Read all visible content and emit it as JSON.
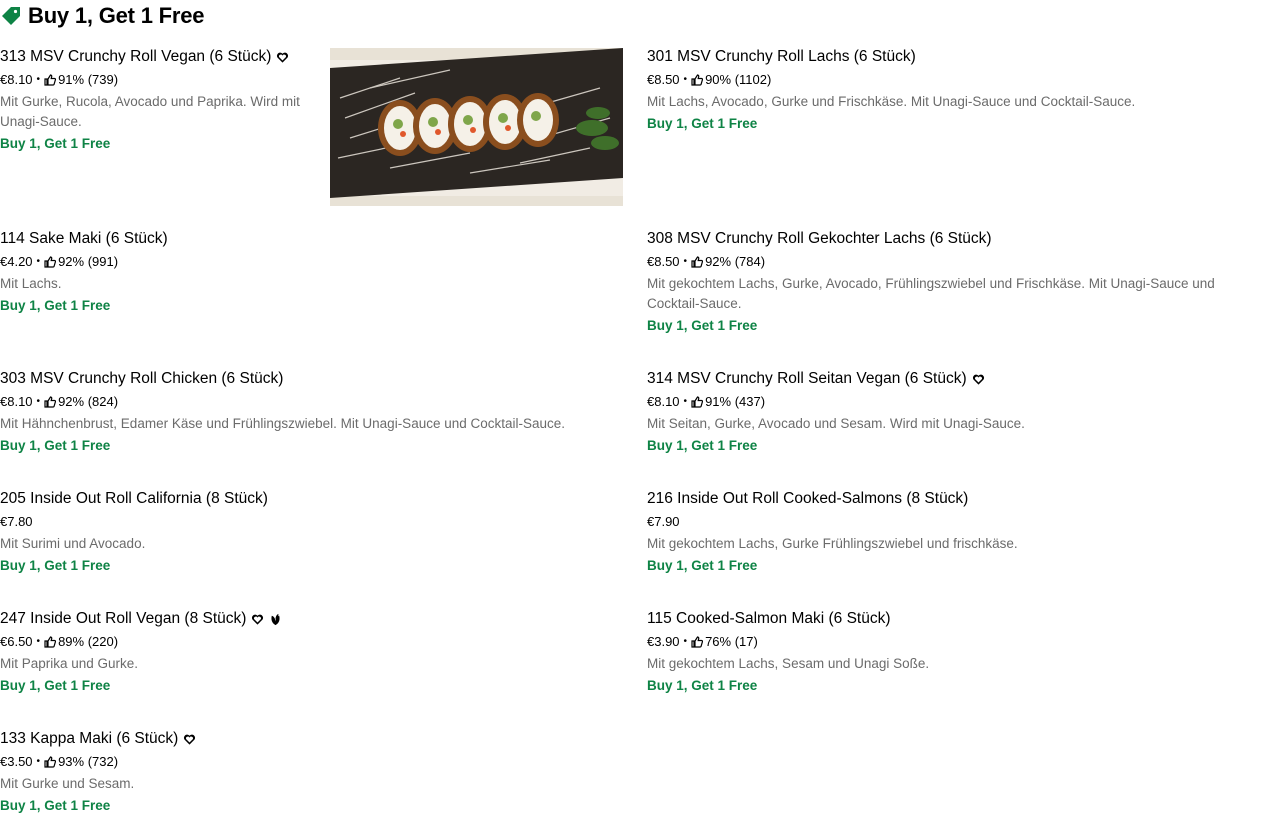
{
  "section": {
    "title": "Buy 1, Get 1 Free",
    "icon": "tag-icon",
    "accent": "#0e8345"
  },
  "items": [
    {
      "title": "313 MSV Crunchy Roll Vegan (6 Stück)",
      "price": "€8.10",
      "rating": "91% (739)",
      "desc": "Mit Gurke, Rucola, Avocado und Paprika. Wird mit Unagi-Sauce.",
      "promo": "Buy 1, Get 1 Free",
      "badges": [
        "heart-icon"
      ],
      "has_image": true
    },
    {
      "title": "301 MSV Crunchy Roll Lachs (6 Stück)",
      "price": "€8.50",
      "rating": "90% (1102)",
      "desc": "Mit Lachs, Avocado, Gurke und Frischkäse. Mit Unagi-Sauce und Cocktail-Sauce.",
      "promo": "Buy 1, Get 1 Free",
      "badges": []
    },
    {
      "title": "114 Sake Maki (6 Stück)",
      "price": "€4.20",
      "rating": "92% (991)",
      "desc": "Mit Lachs.",
      "promo": "Buy 1, Get 1 Free",
      "badges": []
    },
    {
      "title": "308 MSV Crunchy Roll Gekochter Lachs (6 Stück)",
      "price": "€8.50",
      "rating": "92% (784)",
      "desc": "Mit gekochtem Lachs, Gurke, Avocado, Frühlingszwiebel und Frischkäse. Mit Unagi-Sauce und Cocktail-Sauce.",
      "promo": "Buy 1, Get 1 Free",
      "badges": []
    },
    {
      "title": "303 MSV Crunchy Roll Chicken (6 Stück)",
      "price": "€8.10",
      "rating": "92% (824)",
      "desc": "Mit Hähnchenbrust, Edamer Käse und Frühlingszwiebel. Mit Unagi-Sauce und Cocktail-Sauce.",
      "promo": "Buy 1, Get 1 Free",
      "badges": []
    },
    {
      "title": "314 MSV Crunchy Roll Seitan Vegan (6 Stück)",
      "price": "€8.10",
      "rating": "91% (437)",
      "desc": "Mit Seitan, Gurke, Avocado und Sesam. Wird mit Unagi-Sauce.",
      "promo": "Buy 1, Get 1 Free",
      "badges": [
        "heart-icon"
      ]
    },
    {
      "title": "205 Inside Out Roll California (8 Stück)",
      "price": "€7.80",
      "rating": "",
      "desc": "Mit Surimi und Avocado.",
      "promo": "Buy 1, Get 1 Free",
      "badges": []
    },
    {
      "title": "216 Inside Out Roll Cooked-Salmons (8 Stück)",
      "price": "€7.90",
      "rating": "",
      "desc": "Mit gekochtem Lachs, Gurke Frühlingszwiebel und frischkäse.",
      "promo": "Buy 1, Get 1 Free",
      "badges": []
    },
    {
      "title": "247 Inside Out Roll Vegan (8 Stück)",
      "price": "€6.50",
      "rating": "89% (220)",
      "desc": "Mit Paprika und Gurke.",
      "promo": "Buy 1, Get 1 Free",
      "badges": [
        "heart-icon",
        "leaf-icon"
      ]
    },
    {
      "title": "115 Cooked-Salmon Maki (6 Stück)",
      "price": "€3.90",
      "rating": "76% (17)",
      "desc": "Mit gekochtem Lachs, Sesam und Unagi Soße.",
      "promo": "Buy 1, Get 1 Free",
      "badges": []
    },
    {
      "title": "133 Kappa Maki (6 Stück)",
      "price": "€3.50",
      "rating": "93% (732)",
      "desc": "Mit Gurke und Sesam.",
      "promo": "Buy 1, Get 1 Free",
      "badges": [
        "heart-icon"
      ]
    }
  ]
}
